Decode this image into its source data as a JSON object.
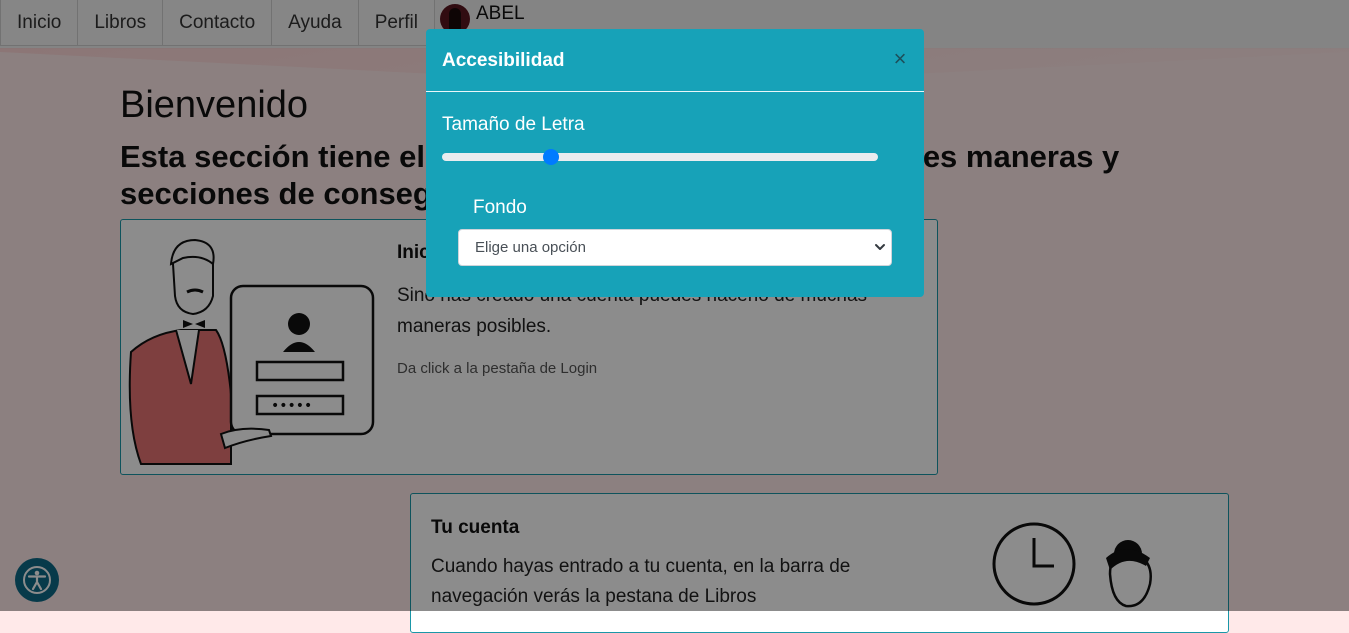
{
  "nav": {
    "items": [
      {
        "label": "Inicio"
      },
      {
        "label": "Libros"
      },
      {
        "label": "Contacto"
      },
      {
        "label": "Ayuda"
      },
      {
        "label": "Perfil"
      }
    ],
    "user_name": "ABEL"
  },
  "main": {
    "heading": "Bienvenido",
    "subheading": "Esta sección tiene el objetivo de mostrarte las diferentes maneras y secciones de conseguir libros con nosotros.",
    "card1": {
      "title": "Inicio de sesión",
      "text": "Sino has creado una cuenta puedes hacerlo de muchas maneras posibles.",
      "hint": "Da click a la pestaña de Login"
    },
    "card2": {
      "title": "Tu cuenta",
      "text": "Cuando hayas entrado a tu cuenta, en la barra de navegación verás la pestana de Libros"
    }
  },
  "modal": {
    "title": "Accesibilidad",
    "close_glyph": "×",
    "font_size_label": "Tamaño de Letra",
    "font_size_value": 0.25,
    "background_label": "Fondo",
    "background_select_value": "Elige una opción"
  },
  "colors": {
    "modal_bg": "#17a2b8",
    "slider_thumb": "#007bff",
    "card_border": "#1a97a8",
    "accessibility_button": "#0d6a88"
  }
}
